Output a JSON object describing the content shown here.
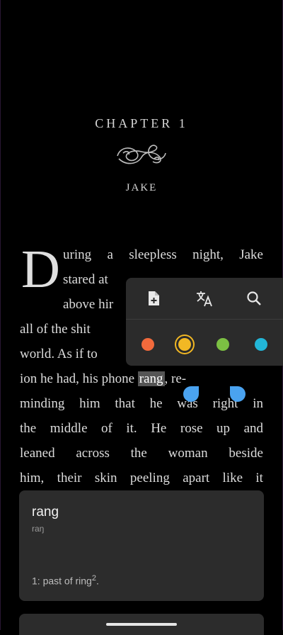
{
  "chapter": {
    "title": "CHAPTER 1",
    "subtitle": "JAKE",
    "ornament_icon": "flourish-ornament"
  },
  "text": {
    "dropcap": "D",
    "lines": [
      {
        "words": [
          "uring",
          "a",
          "sleepless",
          "night,",
          "Jake"
        ]
      },
      {
        "text": "stared at"
      },
      {
        "text": "above hir"
      },
      {
        "text": "all of the shit"
      },
      {
        "text": "world. As if to"
      },
      {
        "text": "ion he had, his phone"
      },
      {
        "selected": "rang",
        "after": ", re-"
      },
      {
        "words": [
          "minding",
          "him",
          "that",
          "he",
          "was",
          "right",
          "in"
        ]
      },
      {
        "words": [
          "the",
          "middle",
          "of",
          "it.",
          "He",
          "rose",
          "up",
          "and"
        ]
      },
      {
        "words": [
          "leaned",
          "across",
          "the",
          "woman",
          "beside"
        ]
      },
      {
        "words": [
          "him,",
          "their",
          "skin",
          "peeling",
          "apart",
          "like",
          "it"
        ]
      }
    ]
  },
  "selection_popup": {
    "tools": [
      {
        "name": "add-note-icon"
      },
      {
        "name": "translate-icon"
      },
      {
        "name": "search-icon"
      }
    ],
    "highlight_colors": [
      {
        "name": "orange",
        "color": "#f26a3c",
        "selected": false
      },
      {
        "name": "yellow",
        "color": "#f2b824",
        "selected": true
      },
      {
        "name": "green",
        "color": "#7cc043",
        "selected": false
      },
      {
        "name": "blue",
        "color": "#22b6d8",
        "selected": false
      }
    ]
  },
  "definition_card": {
    "word": "rang",
    "phonetic": "raŋ",
    "definition": "1: past of ring",
    "superscript": "2",
    "trailing": "."
  }
}
